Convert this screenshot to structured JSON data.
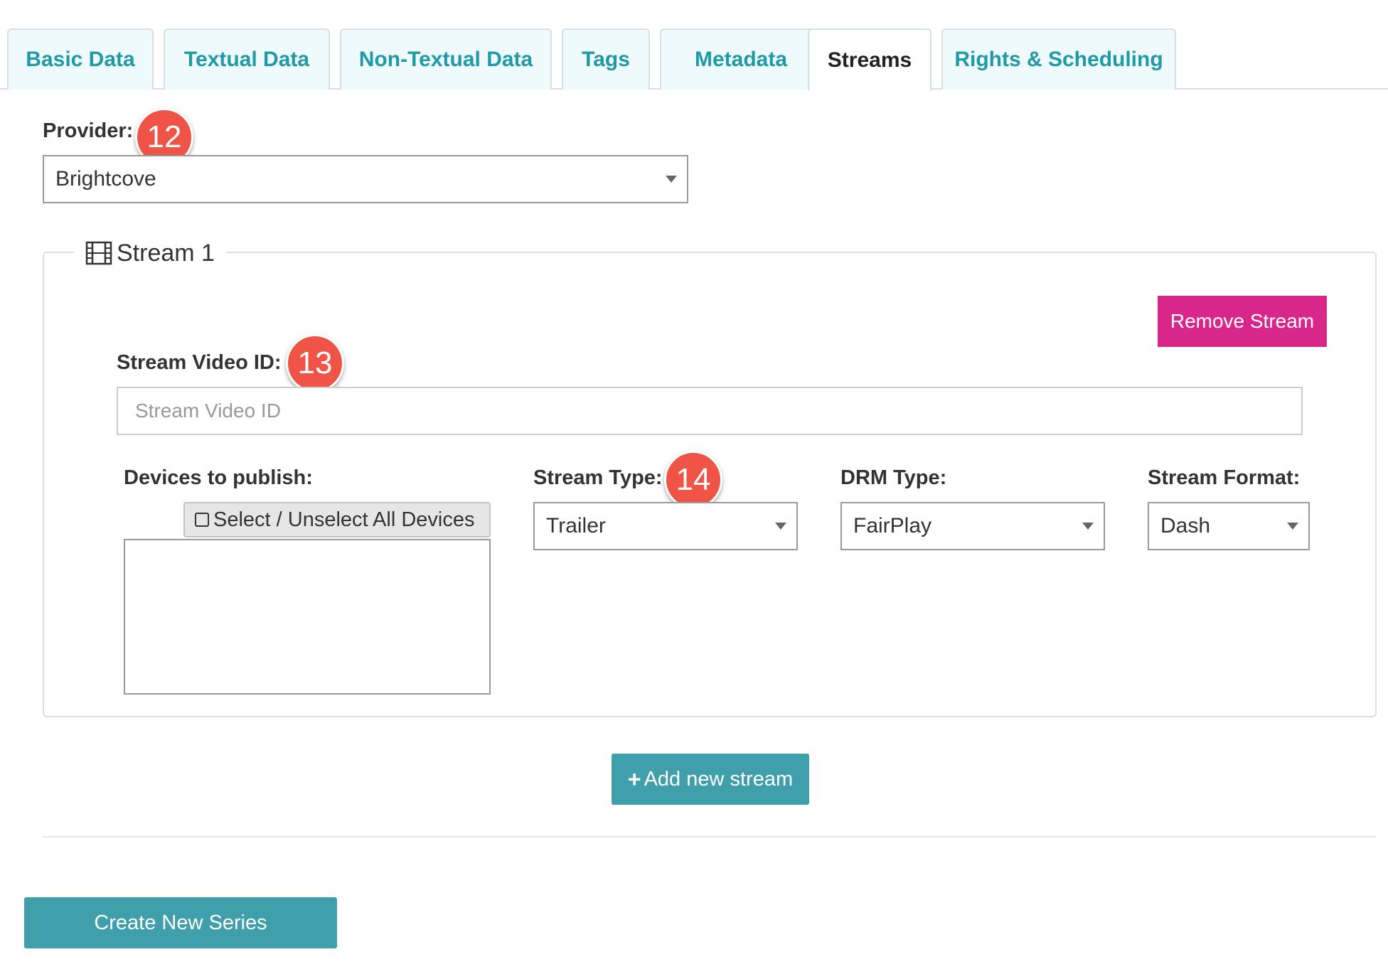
{
  "tabs": [
    {
      "label": "Basic Data",
      "active": false
    },
    {
      "label": "Textual Data",
      "active": false
    },
    {
      "label": "Non-Textual Data",
      "active": false
    },
    {
      "label": "Tags",
      "active": false
    },
    {
      "label": "Metadata",
      "active": false
    },
    {
      "label": "Streams",
      "active": true
    },
    {
      "label": "Rights & Scheduling",
      "active": false
    }
  ],
  "provider": {
    "label": "Provider:",
    "value": "Brightcove",
    "badge": "12"
  },
  "stream": {
    "legend": "Stream 1",
    "legend_icon": "film-icon",
    "remove_label": "Remove Stream",
    "video_id": {
      "label": "Stream Video ID:",
      "placeholder": "Stream Video ID",
      "value": "",
      "badge": "13"
    },
    "devices": {
      "label": "Devices to publish:",
      "select_all_label": "Select / Unselect All Devices"
    },
    "stream_type": {
      "label": "Stream Type:",
      "value": "Trailer",
      "badge": "14"
    },
    "drm_type": {
      "label": "DRM Type:",
      "value": "FairPlay"
    },
    "stream_format": {
      "label": "Stream Format:",
      "value": "Dash"
    }
  },
  "add_stream_label": "Add new stream",
  "create_label": "Create New Series",
  "colors": {
    "accent": "#1f9aa6",
    "button": "#3f9faa",
    "danger": "#d9268a",
    "badge": "#ef5447"
  }
}
